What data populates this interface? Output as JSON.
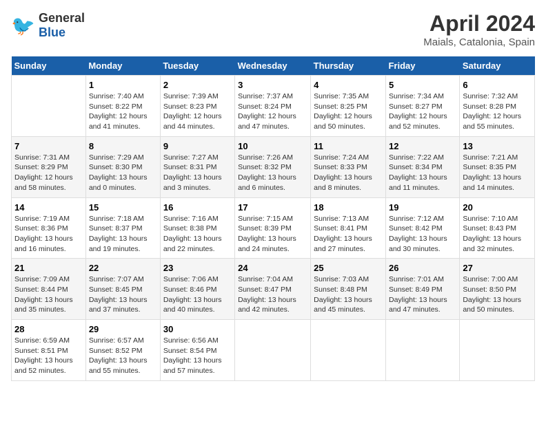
{
  "header": {
    "logo_general": "General",
    "logo_blue": "Blue",
    "title": "April 2024",
    "location": "Maials, Catalonia, Spain"
  },
  "days_of_week": [
    "Sunday",
    "Monday",
    "Tuesday",
    "Wednesday",
    "Thursday",
    "Friday",
    "Saturday"
  ],
  "weeks": [
    [
      {
        "day": "",
        "info": ""
      },
      {
        "day": "1",
        "info": "Sunrise: 7:40 AM\nSunset: 8:22 PM\nDaylight: 12 hours\nand 41 minutes."
      },
      {
        "day": "2",
        "info": "Sunrise: 7:39 AM\nSunset: 8:23 PM\nDaylight: 12 hours\nand 44 minutes."
      },
      {
        "day": "3",
        "info": "Sunrise: 7:37 AM\nSunset: 8:24 PM\nDaylight: 12 hours\nand 47 minutes."
      },
      {
        "day": "4",
        "info": "Sunrise: 7:35 AM\nSunset: 8:25 PM\nDaylight: 12 hours\nand 50 minutes."
      },
      {
        "day": "5",
        "info": "Sunrise: 7:34 AM\nSunset: 8:27 PM\nDaylight: 12 hours\nand 52 minutes."
      },
      {
        "day": "6",
        "info": "Sunrise: 7:32 AM\nSunset: 8:28 PM\nDaylight: 12 hours\nand 55 minutes."
      }
    ],
    [
      {
        "day": "7",
        "info": "Sunrise: 7:31 AM\nSunset: 8:29 PM\nDaylight: 12 hours\nand 58 minutes."
      },
      {
        "day": "8",
        "info": "Sunrise: 7:29 AM\nSunset: 8:30 PM\nDaylight: 13 hours\nand 0 minutes."
      },
      {
        "day": "9",
        "info": "Sunrise: 7:27 AM\nSunset: 8:31 PM\nDaylight: 13 hours\nand 3 minutes."
      },
      {
        "day": "10",
        "info": "Sunrise: 7:26 AM\nSunset: 8:32 PM\nDaylight: 13 hours\nand 6 minutes."
      },
      {
        "day": "11",
        "info": "Sunrise: 7:24 AM\nSunset: 8:33 PM\nDaylight: 13 hours\nand 8 minutes."
      },
      {
        "day": "12",
        "info": "Sunrise: 7:22 AM\nSunset: 8:34 PM\nDaylight: 13 hours\nand 11 minutes."
      },
      {
        "day": "13",
        "info": "Sunrise: 7:21 AM\nSunset: 8:35 PM\nDaylight: 13 hours\nand 14 minutes."
      }
    ],
    [
      {
        "day": "14",
        "info": "Sunrise: 7:19 AM\nSunset: 8:36 PM\nDaylight: 13 hours\nand 16 minutes."
      },
      {
        "day": "15",
        "info": "Sunrise: 7:18 AM\nSunset: 8:37 PM\nDaylight: 13 hours\nand 19 minutes."
      },
      {
        "day": "16",
        "info": "Sunrise: 7:16 AM\nSunset: 8:38 PM\nDaylight: 13 hours\nand 22 minutes."
      },
      {
        "day": "17",
        "info": "Sunrise: 7:15 AM\nSunset: 8:39 PM\nDaylight: 13 hours\nand 24 minutes."
      },
      {
        "day": "18",
        "info": "Sunrise: 7:13 AM\nSunset: 8:41 PM\nDaylight: 13 hours\nand 27 minutes."
      },
      {
        "day": "19",
        "info": "Sunrise: 7:12 AM\nSunset: 8:42 PM\nDaylight: 13 hours\nand 30 minutes."
      },
      {
        "day": "20",
        "info": "Sunrise: 7:10 AM\nSunset: 8:43 PM\nDaylight: 13 hours\nand 32 minutes."
      }
    ],
    [
      {
        "day": "21",
        "info": "Sunrise: 7:09 AM\nSunset: 8:44 PM\nDaylight: 13 hours\nand 35 minutes."
      },
      {
        "day": "22",
        "info": "Sunrise: 7:07 AM\nSunset: 8:45 PM\nDaylight: 13 hours\nand 37 minutes."
      },
      {
        "day": "23",
        "info": "Sunrise: 7:06 AM\nSunset: 8:46 PM\nDaylight: 13 hours\nand 40 minutes."
      },
      {
        "day": "24",
        "info": "Sunrise: 7:04 AM\nSunset: 8:47 PM\nDaylight: 13 hours\nand 42 minutes."
      },
      {
        "day": "25",
        "info": "Sunrise: 7:03 AM\nSunset: 8:48 PM\nDaylight: 13 hours\nand 45 minutes."
      },
      {
        "day": "26",
        "info": "Sunrise: 7:01 AM\nSunset: 8:49 PM\nDaylight: 13 hours\nand 47 minutes."
      },
      {
        "day": "27",
        "info": "Sunrise: 7:00 AM\nSunset: 8:50 PM\nDaylight: 13 hours\nand 50 minutes."
      }
    ],
    [
      {
        "day": "28",
        "info": "Sunrise: 6:59 AM\nSunset: 8:51 PM\nDaylight: 13 hours\nand 52 minutes."
      },
      {
        "day": "29",
        "info": "Sunrise: 6:57 AM\nSunset: 8:52 PM\nDaylight: 13 hours\nand 55 minutes."
      },
      {
        "day": "30",
        "info": "Sunrise: 6:56 AM\nSunset: 8:54 PM\nDaylight: 13 hours\nand 57 minutes."
      },
      {
        "day": "",
        "info": ""
      },
      {
        "day": "",
        "info": ""
      },
      {
        "day": "",
        "info": ""
      },
      {
        "day": "",
        "info": ""
      }
    ]
  ]
}
